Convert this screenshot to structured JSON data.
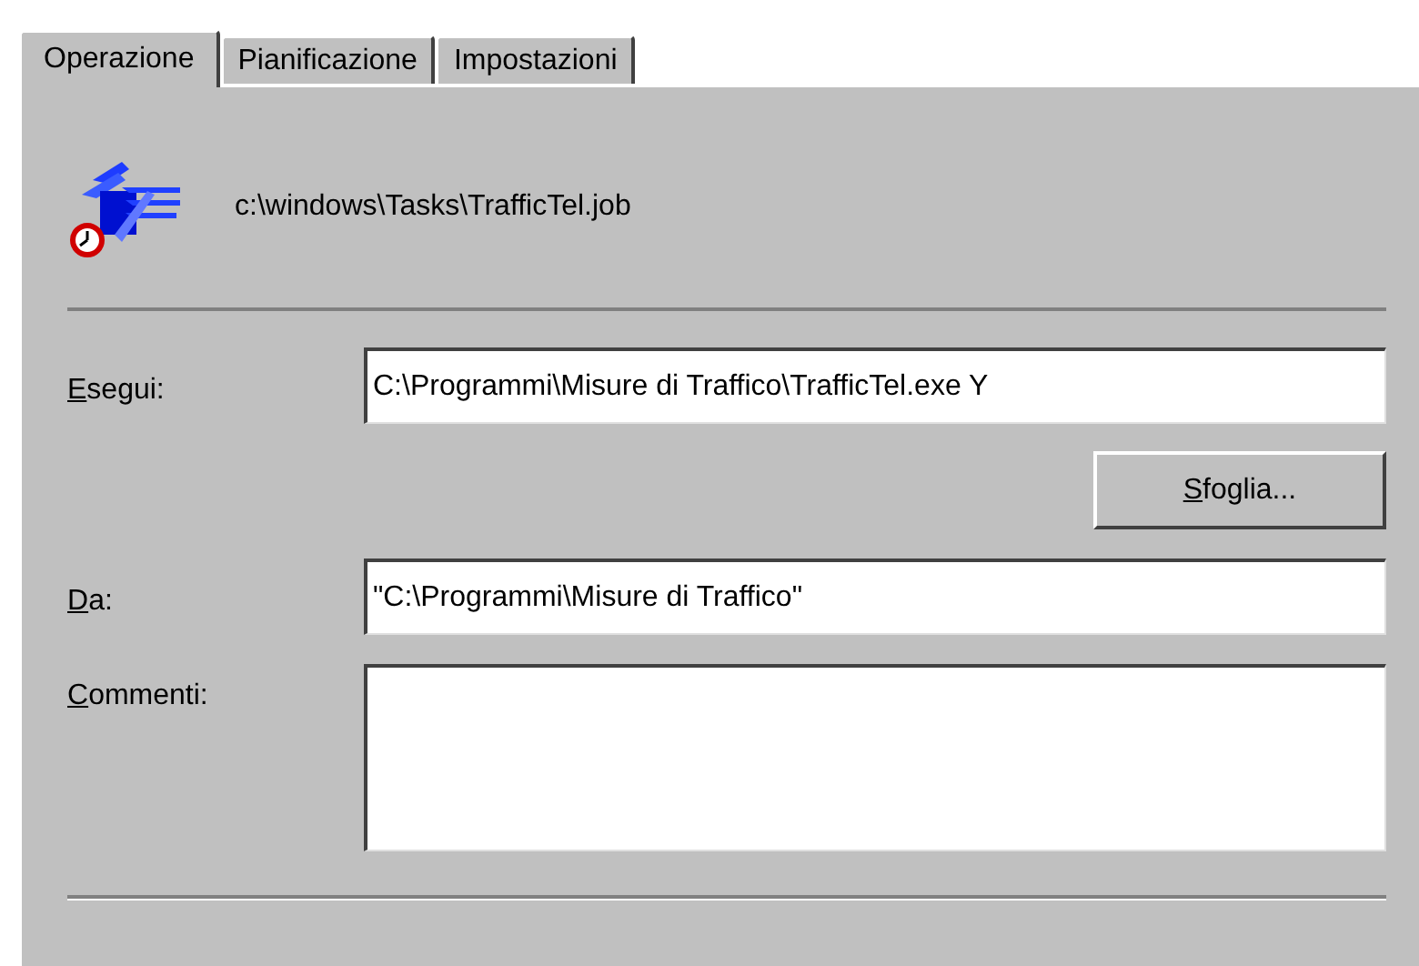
{
  "tabs": [
    {
      "label": "Operazione",
      "selected": true
    },
    {
      "label": "Pianificazione",
      "selected": false
    },
    {
      "label": "Impostazioni",
      "selected": false
    }
  ],
  "task_path": "c:\\windows\\Tasks\\TrafficTel.job",
  "fields": [
    {
      "kind": "line",
      "label": "Esegui:",
      "value": "C:\\Programmi\\Misure di Traffico\\TrafficTel.exe Y",
      "button": "Sfoglia..."
    },
    {
      "kind": "line",
      "label": "Da:",
      "value": "\"C:\\Programmi\\Misure di Traffico\""
    },
    {
      "kind": "area",
      "label": "Commenti:"
    }
  ]
}
